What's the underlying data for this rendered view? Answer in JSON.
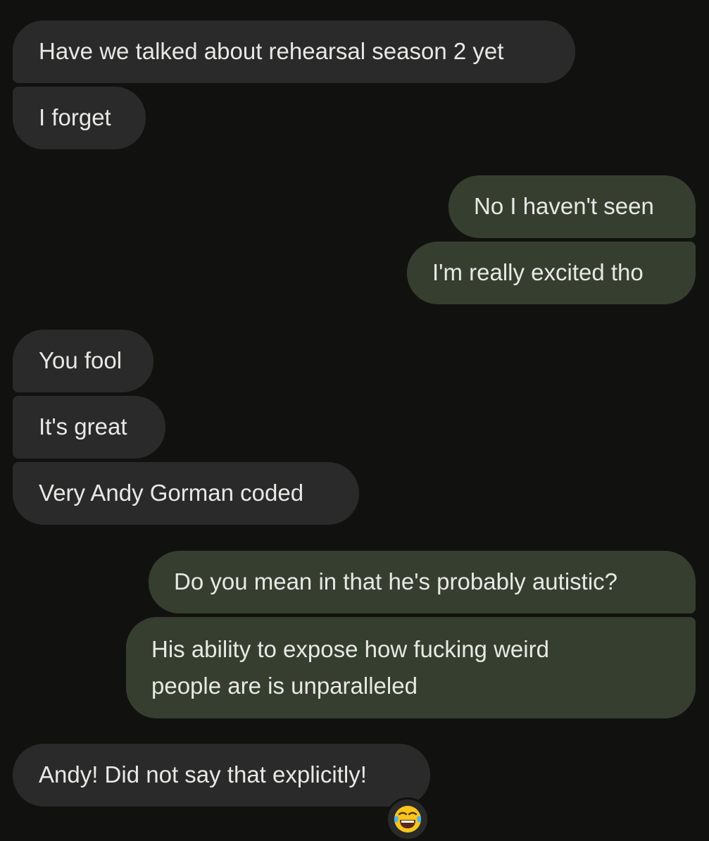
{
  "messages": [
    {
      "id": "m1",
      "direction": "incoming",
      "text": "Have we talked about rehearsal season 2 yet"
    },
    {
      "id": "m2",
      "direction": "incoming",
      "text": "I forget"
    },
    {
      "id": "m3",
      "direction": "outgoing",
      "text": "No I haven't seen"
    },
    {
      "id": "m4",
      "direction": "outgoing",
      "text": "I'm really excited tho"
    },
    {
      "id": "m5",
      "direction": "incoming",
      "text": "You fool"
    },
    {
      "id": "m6",
      "direction": "incoming",
      "text": "It's great"
    },
    {
      "id": "m7",
      "direction": "incoming",
      "text": "Very Andy Gorman coded"
    },
    {
      "id": "m8",
      "direction": "outgoing",
      "text": "Do you mean in that he's probably autistic?"
    },
    {
      "id": "m9",
      "direction": "outgoing",
      "text": "His ability to expose how fucking weird people are is unparalleled"
    },
    {
      "id": "m10",
      "direction": "incoming",
      "text": "Andy! Did not say that explicitly!"
    }
  ],
  "reaction": {
    "icon": "face-with-tears-of-joy-icon",
    "emoji": "😂"
  },
  "colors": {
    "background": "#111210",
    "incoming_bubble": "#2a2a2a",
    "outgoing_bubble": "#363f2f",
    "text": "#e8e8e6"
  }
}
